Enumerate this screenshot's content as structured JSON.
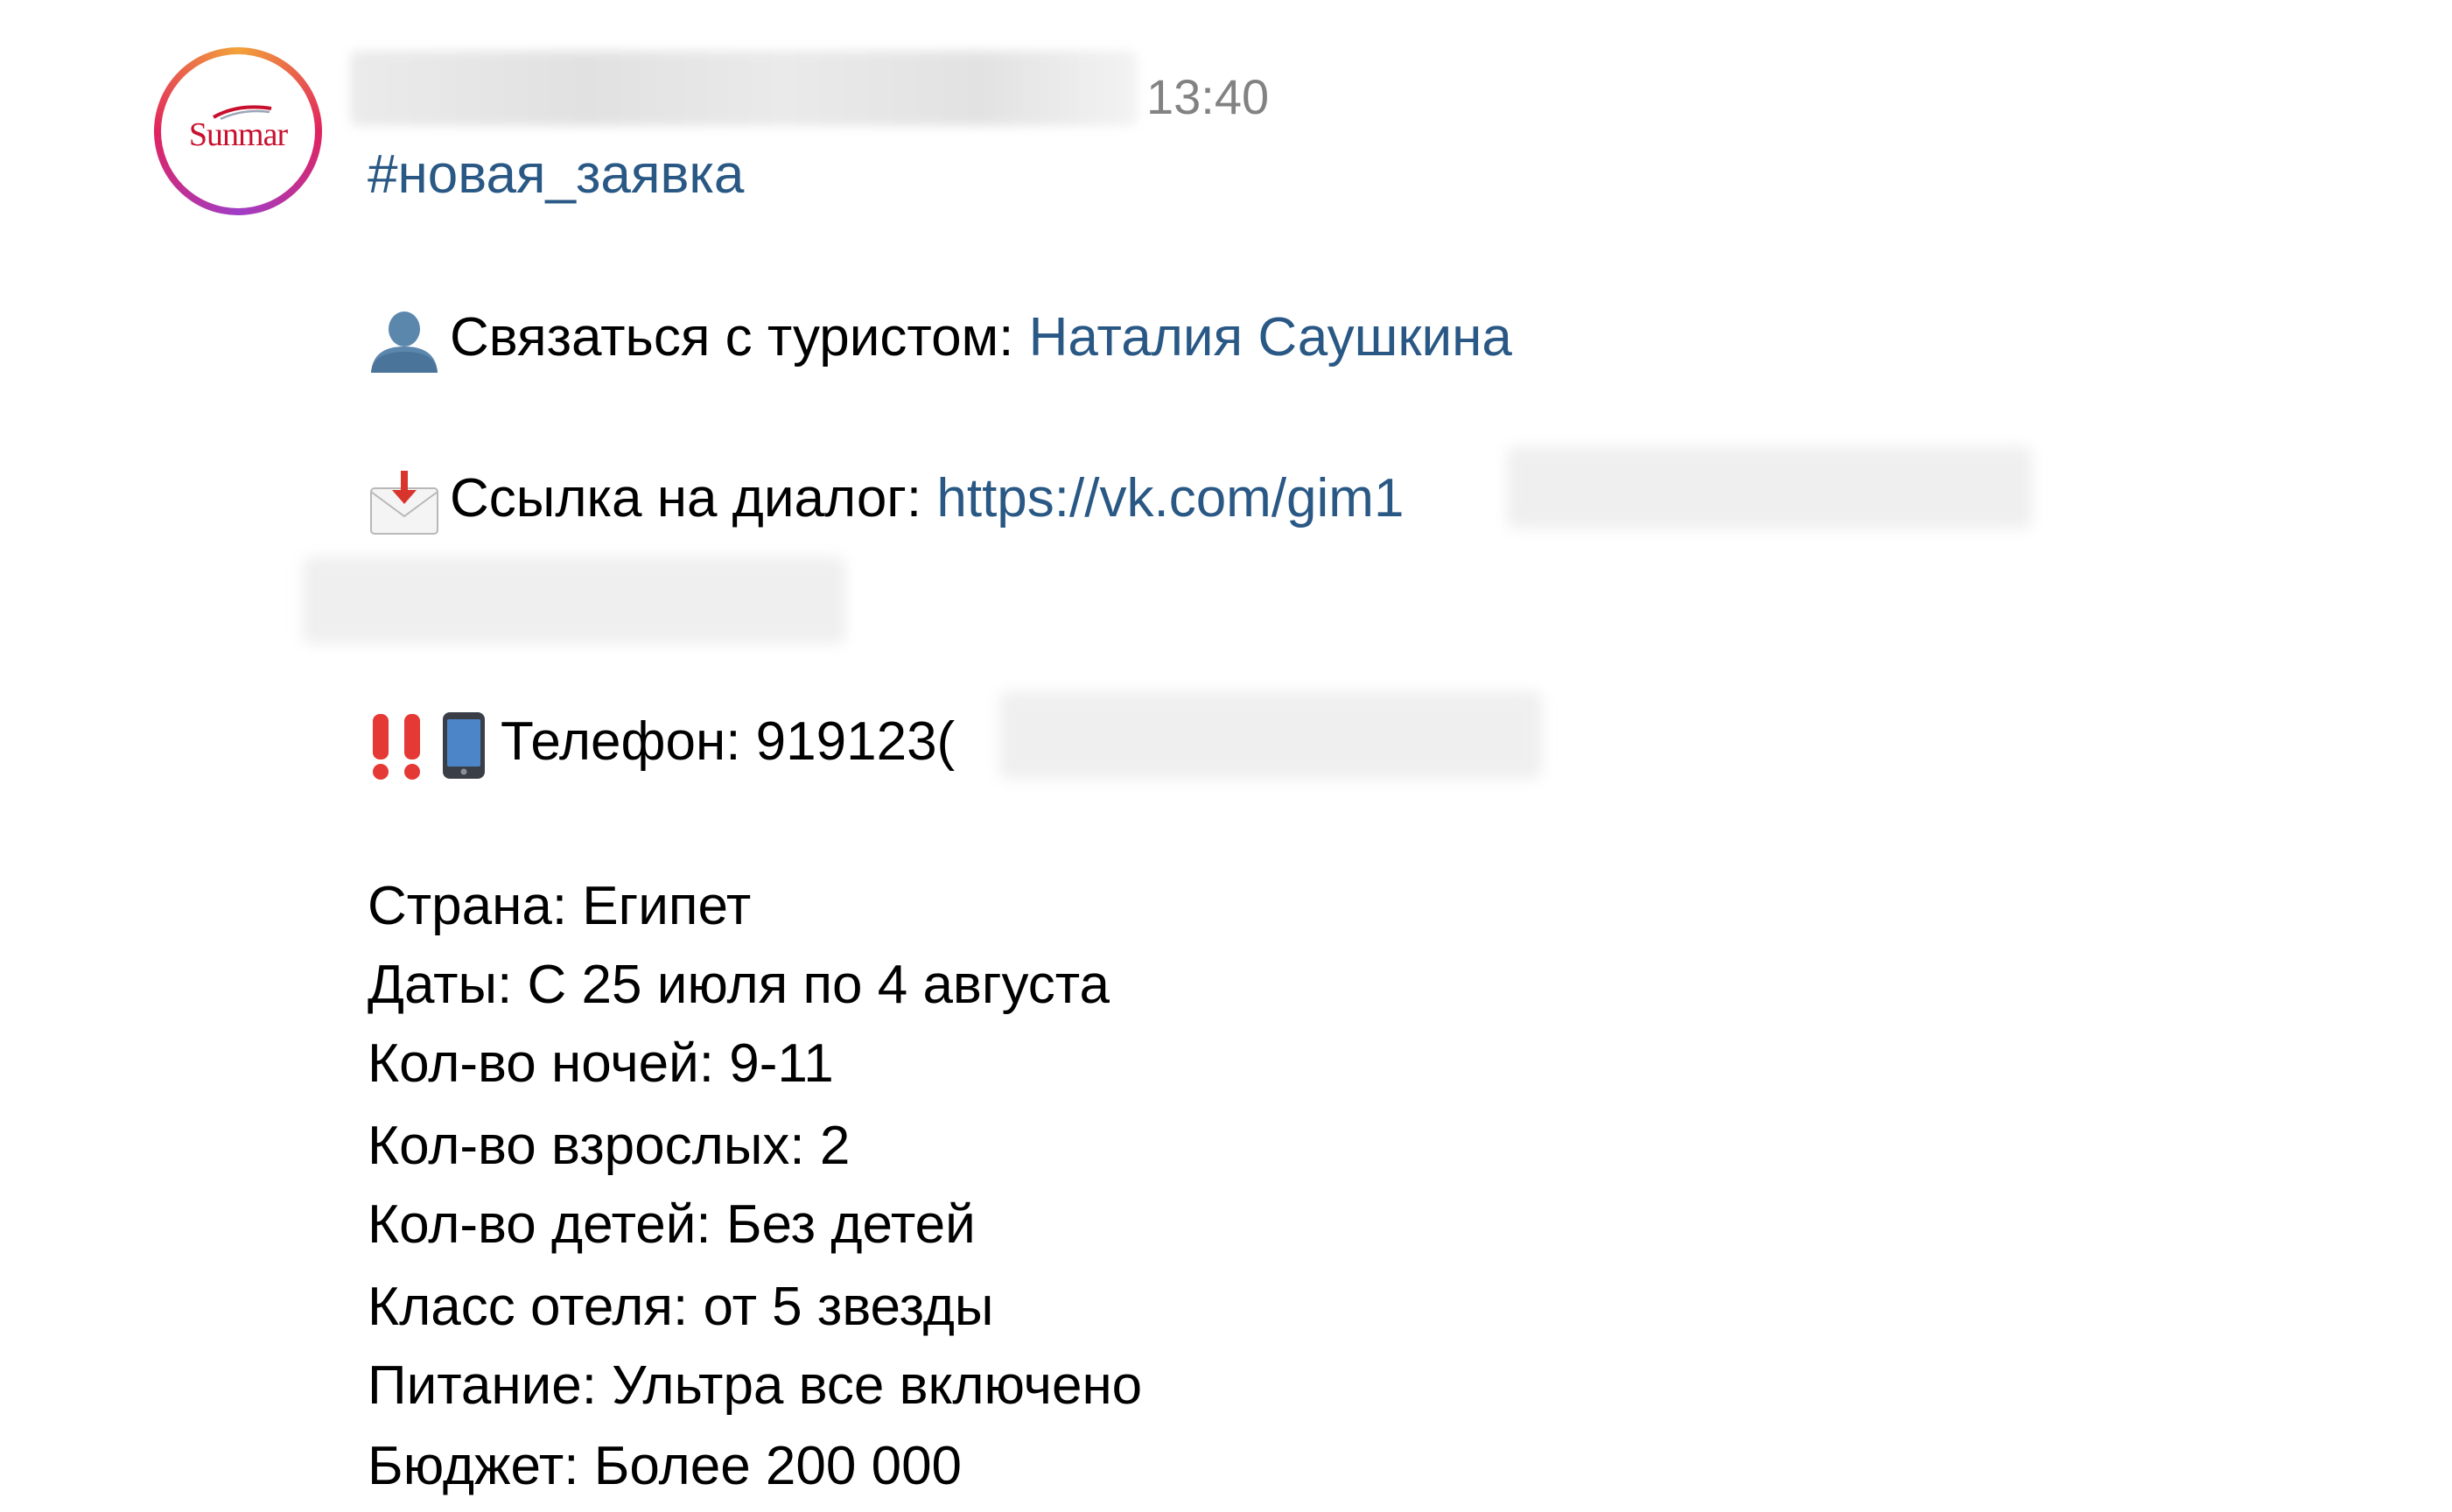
{
  "message": {
    "avatar_text": "Sunmar",
    "time": "13:40",
    "hashtag": "#новая_заявка",
    "contact": {
      "label": "Связаться с туристом:",
      "name": "Наталия Саушкина"
    },
    "dialog": {
      "label": "Ссылка на диалог:",
      "url": "https://vk.com/gim1"
    },
    "phone": {
      "label": "Телефон:",
      "value": "919123("
    },
    "details": [
      "Страна: Египет",
      "Даты: С 25 июля по 4 августа",
      "Кол-во ночей: 9-11",
      "Кол-во взрослых: 2",
      "Кол-во детей: Без детей",
      "Класс отеля: от 5 звезды",
      "Питание: Ультра все включено",
      "Бюджет: Более 200 000"
    ]
  },
  "colors": {
    "link": "#2a5885",
    "time": "#828282",
    "brand_red": "#c8102e"
  },
  "icons": [
    "user-icon",
    "envelope-download-icon",
    "double-exclamation-icon",
    "mobile-phone-icon"
  ]
}
